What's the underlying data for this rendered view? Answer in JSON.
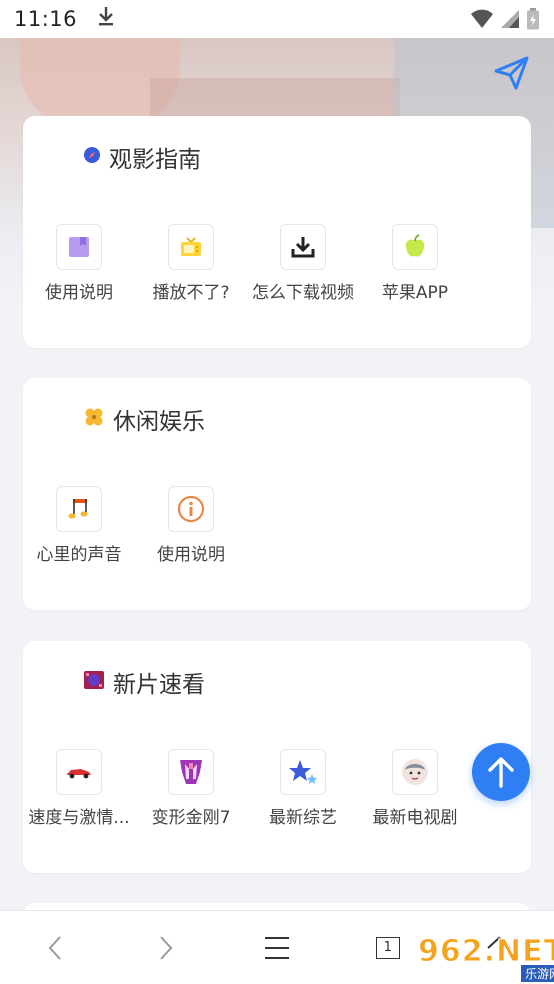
{
  "status_bar": {
    "time": "11:16"
  },
  "sections": [
    {
      "title": "观影指南",
      "items": [
        {
          "label": "使用说明",
          "icon": "bookmark-icon"
        },
        {
          "label": "播放不了?",
          "icon": "tv-icon"
        },
        {
          "label": "怎么下载视频",
          "icon": "download-icon"
        },
        {
          "label": "苹果APP",
          "icon": "apple-icon"
        }
      ]
    },
    {
      "title": "休闲娱乐",
      "items": [
        {
          "label": "心里的声音",
          "icon": "music-note-icon"
        },
        {
          "label": "使用说明",
          "icon": "info-icon"
        }
      ]
    },
    {
      "title": "新片速看",
      "items": [
        {
          "label": "速度与激情...",
          "icon": "race-car-icon"
        },
        {
          "label": "变形金刚7",
          "icon": "transformers-icon"
        },
        {
          "label": "最新综艺",
          "icon": "star-icon"
        },
        {
          "label": "最新电视剧",
          "icon": "avatar-icon"
        }
      ]
    }
  ],
  "bottom_bar": {
    "tab_count": "1"
  },
  "watermark": {
    "main": "962.NET",
    "sub": "乐游网"
  },
  "colors": {
    "accent": "#2f7ef4",
    "background": "#f1f3f7"
  }
}
